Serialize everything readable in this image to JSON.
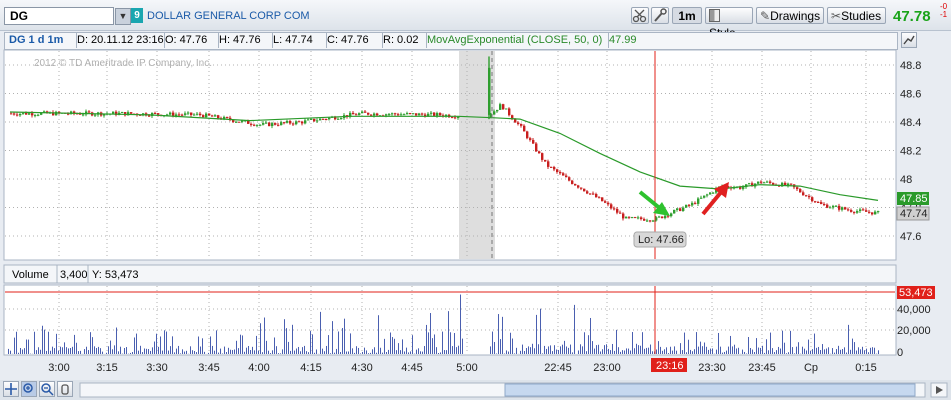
{
  "toolbar": {
    "symbol": "DG",
    "badge": "9",
    "company": "DOLLAR GENERAL CORP COM",
    "interval": "1m",
    "style_label": "Style",
    "drawings_label": "Drawings",
    "studies_label": "Studies",
    "last_price": "47.78",
    "change_top": "-0",
    "change_bottom": "-1"
  },
  "infobar": {
    "title": "DG 1 d 1m",
    "date": "D: 20.11.12 23:16",
    "open": "O: 47.76",
    "high": "H: 47.76",
    "low": "L: 47.74",
    "close": "C: 47.76",
    "range": "R: 0.02",
    "study": "MovAvgExponential (CLOSE, 50, 0)",
    "study_value": "47.99"
  },
  "watermark": "2012 © TD Ameritrade IP Company, Inc.",
  "price_axis": {
    "ticks": [
      "48.8",
      "48.6",
      "48.4",
      "48.2",
      "48",
      "47.8",
      "47.6"
    ],
    "ma_label": "47.85",
    "last_label": "47.74"
  },
  "low_marker": "Lo: 47.66",
  "volume_panel": {
    "label": "Volume",
    "volume": "3,400",
    "y_value": "Y: 53,473",
    "cursor_label": "53,473",
    "ticks": [
      "40,000",
      "20,000",
      "0"
    ]
  },
  "time_axis": {
    "ticks": [
      "3:00",
      "3:15",
      "3:30",
      "3:45",
      "4:00",
      "4:15",
      "4:30",
      "4:45",
      "5:00",
      "22:45",
      "23:00",
      "23:30",
      "23:45",
      "Cp",
      "0:15"
    ],
    "cursor_label": "23:16"
  },
  "colors": {
    "up": "#2e9e2e",
    "down": "#c81e1e",
    "ema": "#2a9a2a",
    "volume": "#4a5fb0",
    "cursor": "#e0201a"
  }
}
